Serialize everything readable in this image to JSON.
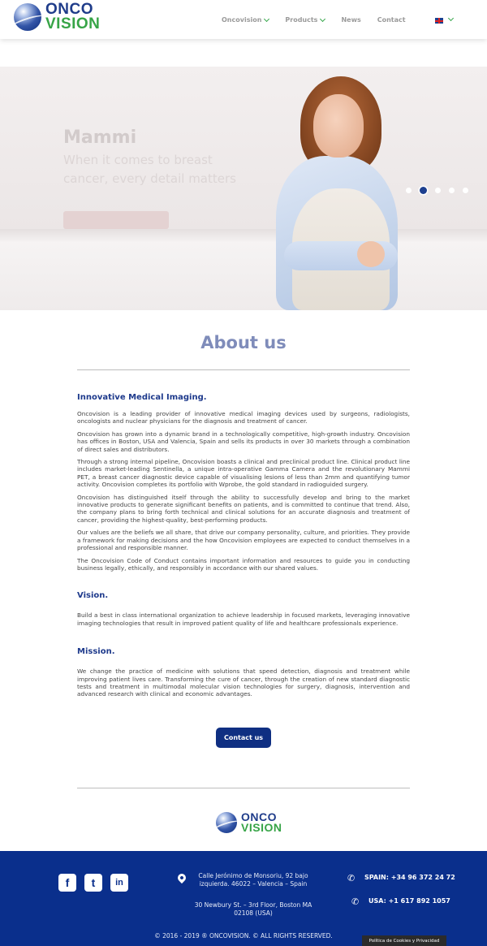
{
  "header": {
    "logo": {
      "line1": "ONCO",
      "line2": "VISION"
    },
    "nav": [
      {
        "label": "Oncovision",
        "has_dropdown": true
      },
      {
        "label": "Products",
        "has_dropdown": true
      },
      {
        "label": "News",
        "has_dropdown": false
      },
      {
        "label": "Contact",
        "has_dropdown": false
      }
    ],
    "language_flag": "uk-flag-icon"
  },
  "hero": {
    "title": "Mammi",
    "subtitle": "When it comes to breast cancer, every detail matters",
    "slides_count": 5,
    "active_slide": 2
  },
  "about": {
    "title": "About us",
    "section1_title": "Innovative Medical Imaging",
    "paragraphs": [
      "Oncovision is a leading provider of innovative medical imaging devices used by surgeons, radiologists, oncologists and nuclear physicians for the diagnosis and treatment of cancer.",
      "Oncovision has grown into a dynamic brand in a technologically competitive, high-growth industry. Oncovision has offices in Boston, USA and Valencia, Spain and sells its products in over 30 markets through a combination of direct sales and distributors.",
      "Through a strong internal pipeline, Oncovision boasts a clinical and preclinical product line. Clinical product line includes market-leading Sentinella, a unique intra-operative Gamma Camera and the revolutionary Mammi PET, a breast cancer diagnostic device capable of visualising lesions of less than 2mm and quantifying tumor activity. Oncovision completes its portfolio with Wprobe, the gold standard in radioguided surgery.",
      "Oncovision has distinguished itself through the ability to successfully develop and bring to the market innovative products to generate significant benefits on patients, and is committed to continue that trend. Also, the company plans to bring forth technical and clinical solutions for an accurate diagnosis and treatment of cancer, providing the highest-quality, best-performing products.",
      "Our values are the beliefs we all share, that drive our company personality, culture, and priorities. They provide a framework for making decisions and the how Oncovision employees are expected to conduct themselves in a professional and responsible manner.",
      "The Oncovision Code of Conduct contains important information and resources to guide you in conducting business legally, ethically, and responsibly in accordance with our shared values."
    ],
    "vision_title": "Vision",
    "vision_text": "Build a best in class international organization to achieve leadership in focused markets, leveraging innovative imaging technologies that result in improved patient quality of life and healthcare professionals experience.",
    "mission_title": "Mission",
    "mission_text": "We change the practice of medicine with solutions that speed detection, diagnosis and treatment while improving patient lives care. Transforming the cure of cancer, through the creation of new standard diagnostic tests and treatment in multimodal molecular vision technologies for surgery, diagnosis, intervention and advanced research with clinical and economic advantages.",
    "contact_button": "Contact us"
  },
  "footer": {
    "social": [
      {
        "name": "facebook-icon",
        "glyph": "f"
      },
      {
        "name": "twitter-icon",
        "glyph": "t"
      },
      {
        "name": "linkedin-icon",
        "glyph": "in"
      }
    ],
    "address_spain": "Calle Jerónimo de Monsoriu, 92 bajo izquierda. 46022 – Valencia – Spain",
    "address_usa": "30 Newbury St. – 3rd Floor, Boston MA 02108 (USA)",
    "phone_spain": "SPAIN: +34 96 372 24 72",
    "phone_usa": "USA: +1 617 892 1057",
    "copyright": "© 2016 - 2019 ® ONCOVISION. © ALL RIGHTS RESERVED.",
    "cookie_link": "Política de Cookies y Privacidad"
  },
  "colors": {
    "brand_blue": "#0a2f8c",
    "brand_green": "#37a447",
    "heading_blue": "#1e3a8c",
    "about_title": "#7f8cba"
  }
}
